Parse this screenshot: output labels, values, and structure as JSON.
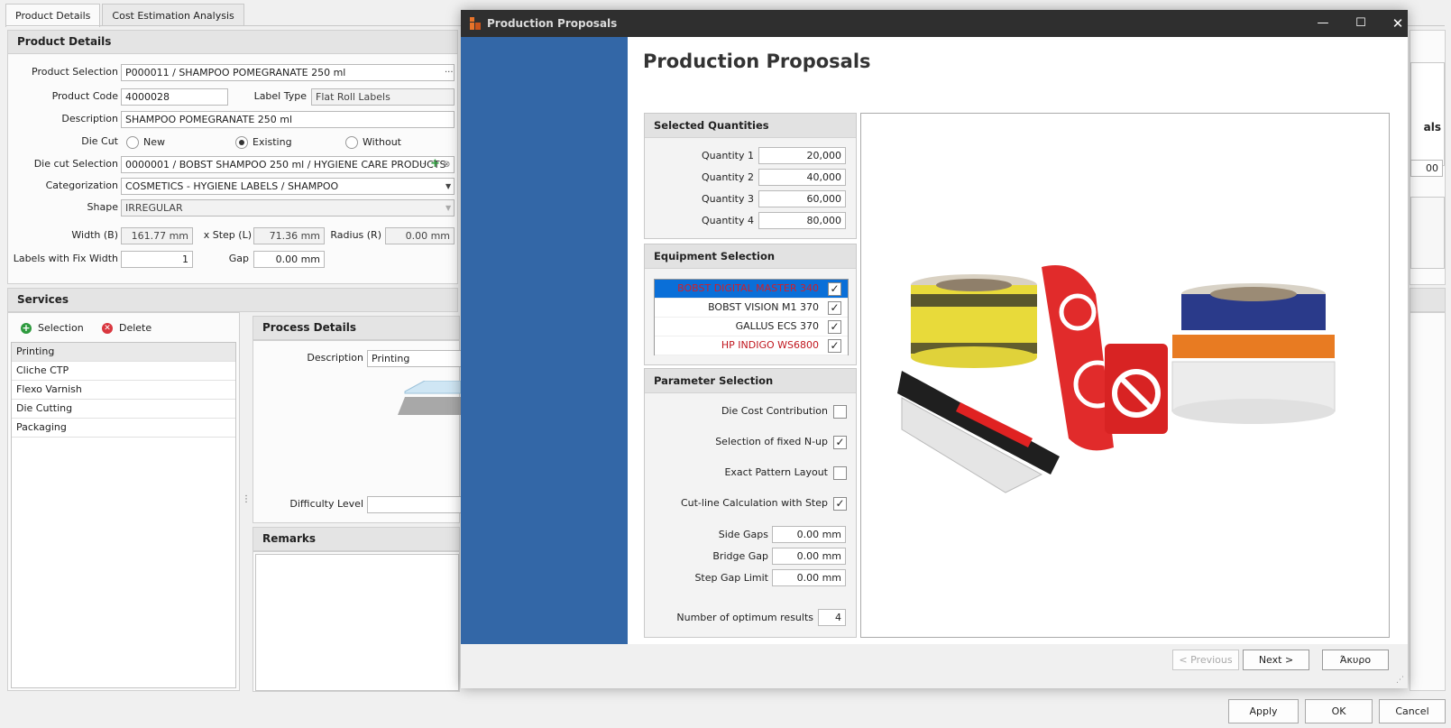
{
  "main": {
    "tabs": [
      {
        "label": "Product Details"
      },
      {
        "label": "Cost Estimation Analysis"
      }
    ],
    "product_details": {
      "header": "Product Details",
      "product_selection_label": "Product Selection",
      "product_selection_value": "P000011 / SHAMPOO POMEGRANATE 250 ml",
      "product_code_label": "Product Code",
      "product_code_value": "4000028",
      "label_type_label": "Label Type",
      "label_type_value": "Flat Roll Labels",
      "description_label": "Description",
      "description_value": "SHAMPOO POMEGRANATE 250 ml",
      "die_cut_label": "Die Cut",
      "die_cut_options": [
        "New",
        "Existing",
        "Without"
      ],
      "die_cut_selected": "Existing",
      "die_cut_selection_label": "Die cut Selection",
      "die_cut_selection_value": "0000001 / BOBST SHAMPOO 250 ml / HYGIENE CARE PRODUCTS",
      "categorization_label": "Categorization",
      "categorization_value": "COSMETICS - HYGIENE LABELS / SHAMPOO",
      "shape_label": "Shape",
      "shape_value": "IRREGULAR",
      "width_label": "Width (B)",
      "width_value": "161.77 mm",
      "step_label": "x  Step (L)",
      "step_value": "71.36 mm",
      "radius_label": "Radius (R)",
      "radius_value": "0.00 mm",
      "fix_width_label": "Labels with Fix Width",
      "fix_width_value": "1",
      "gap_label": "Gap",
      "gap_value": "0.00 mm"
    },
    "services": {
      "header": "Services",
      "selection_label": "Selection",
      "delete_label": "Delete",
      "items": [
        "Printing",
        "Cliche CTP",
        "Flexo Varnish",
        "Die Cutting",
        "Packaging"
      ]
    },
    "process_details": {
      "header": "Process Details",
      "description_label": "Description",
      "description_value": "Printing",
      "difficulty_label": "Difficulty Level"
    },
    "remarks": {
      "header": "Remarks"
    },
    "right_partial": {
      "text": "als",
      "value": "00"
    },
    "footer": {
      "apply": "Apply",
      "ok": "OK",
      "cancel": "Cancel"
    }
  },
  "dialog": {
    "title": "Production Proposals",
    "heading": "Production Proposals",
    "selected_quantities": {
      "header": "Selected Quantities",
      "items": [
        {
          "label": "Quantity 1",
          "value": "20,000"
        },
        {
          "label": "Quantity 2",
          "value": "40,000"
        },
        {
          "label": "Quantity 3",
          "value": "60,000"
        },
        {
          "label": "Quantity 4",
          "value": "80,000"
        }
      ]
    },
    "equipment_selection": {
      "header": "Equipment Selection",
      "items": [
        {
          "label": "BOBST DIGITAL MASTER 340",
          "checked": true,
          "color": "#d0202a",
          "selected": true
        },
        {
          "label": "BOBST VISION M1 370",
          "checked": true,
          "color": "#222222",
          "selected": false
        },
        {
          "label": "GALLUS ECS 370",
          "checked": true,
          "color": "#222222",
          "selected": false
        },
        {
          "label": "HP INDIGO WS6800",
          "checked": true,
          "color": "#c0161e",
          "selected": false
        }
      ]
    },
    "parameter_selection": {
      "header": "Parameter Selection",
      "die_cost_label": "Die Cost Contribution",
      "die_cost_checked": false,
      "fixed_nup_label": "Selection of fixed N-up",
      "fixed_nup_checked": true,
      "exact_pattern_label": "Exact Pattern Layout",
      "exact_pattern_checked": false,
      "cutline_label": "Cut-line Calculation with Step",
      "cutline_checked": true,
      "side_gaps_label": "Side Gaps",
      "side_gaps_value": "0.00 mm",
      "bridge_gap_label": "Bridge Gap",
      "bridge_gap_value": "0.00 mm",
      "step_gap_label": "Step Gap Limit",
      "step_gap_value": "0.00 mm",
      "optimum_label": "Number of optimum results",
      "optimum_value": "4"
    },
    "buttons": {
      "previous": "< Previous",
      "next": "Next >",
      "cancel": "Άκυρο"
    },
    "colors": {
      "sidebar": "#3367a7",
      "titlebar": "#2f2f2f",
      "selection": "#0a6fd8"
    }
  }
}
